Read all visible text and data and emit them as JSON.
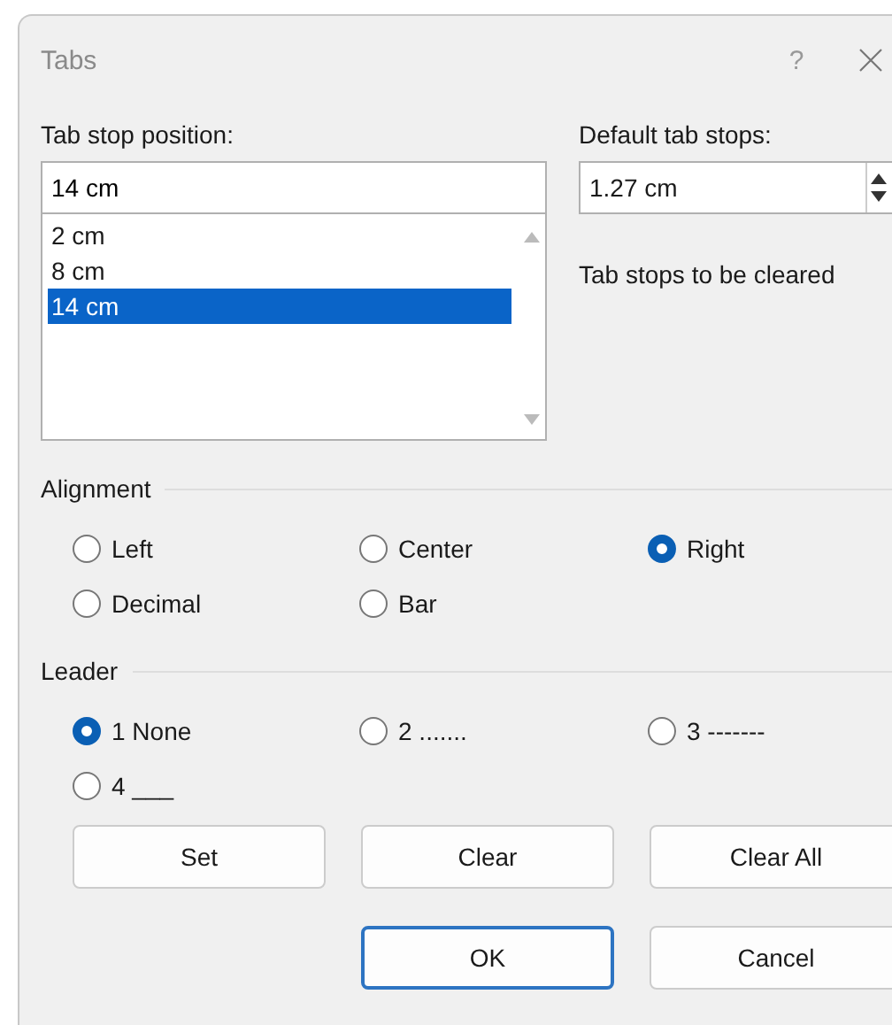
{
  "window": {
    "title": "Tabs",
    "help_button": "?"
  },
  "tab_stop_position": {
    "label": "Tab stop position:",
    "value": "14 cm",
    "list": [
      {
        "text": "2 cm",
        "selected": false
      },
      {
        "text": "8 cm",
        "selected": false
      },
      {
        "text": "14 cm",
        "selected": true
      }
    ]
  },
  "default_tab_stops": {
    "label": "Default tab stops:",
    "value": "1.27 cm"
  },
  "cleared_label": "Tab stops to be cleared",
  "alignment": {
    "title": "Alignment",
    "options": [
      {
        "label": "Left",
        "selected": false
      },
      {
        "label": "Center",
        "selected": false
      },
      {
        "label": "Right",
        "selected": true
      },
      {
        "label": "Decimal",
        "selected": false
      },
      {
        "label": "Bar",
        "selected": false
      }
    ]
  },
  "leader": {
    "title": "Leader",
    "options": [
      {
        "label": "1 None",
        "selected": true
      },
      {
        "label": "2 .......",
        "selected": false
      },
      {
        "label": "3 -------",
        "selected": false
      },
      {
        "label": "4 ___",
        "selected": false
      }
    ]
  },
  "buttons": [
    {
      "label": "Set"
    },
    {
      "label": "Clear"
    },
    {
      "label": "Clear All"
    }
  ],
  "footer_buttons": [
    {
      "label": "OK",
      "default": true
    },
    {
      "label": "Cancel",
      "default": false
    }
  ]
}
